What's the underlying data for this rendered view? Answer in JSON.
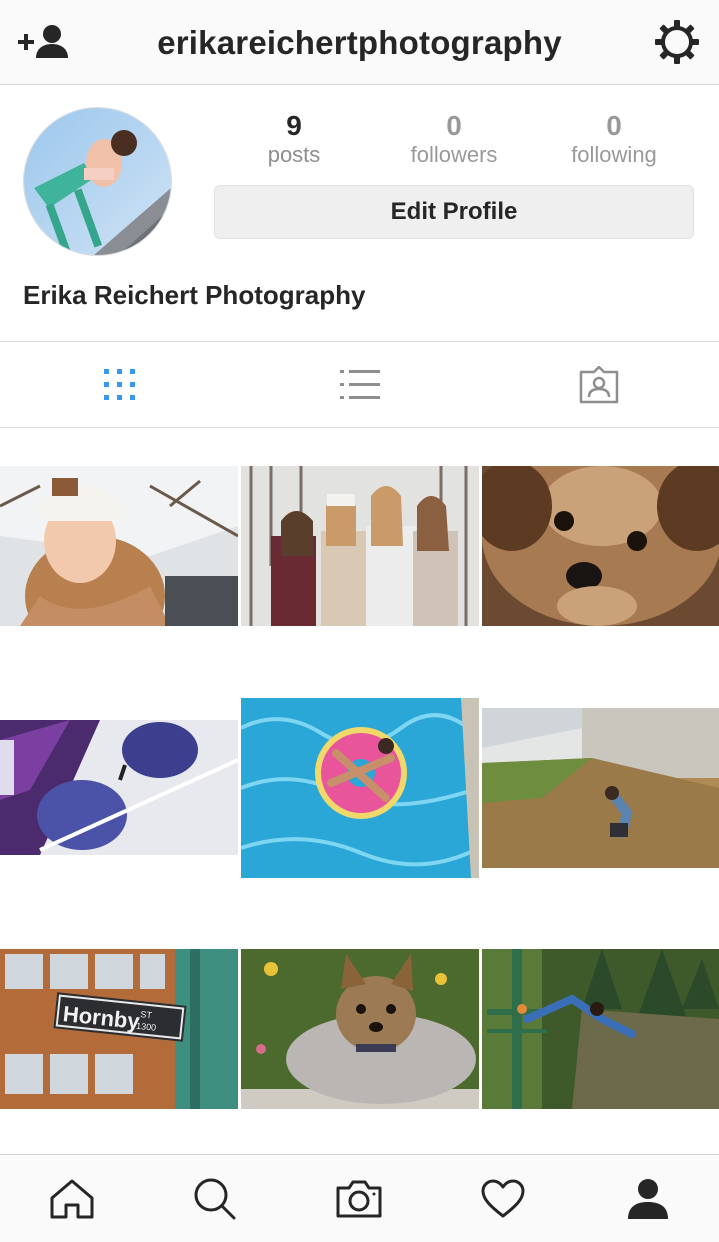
{
  "header": {
    "username": "erikareichertphotography",
    "add_user_icon": "add-person-icon",
    "settings_icon": "gear-icon"
  },
  "profile": {
    "stats": {
      "posts_count": "9",
      "posts_label": "posts",
      "followers_count": "0",
      "followers_label": "followers",
      "following_count": "0",
      "following_label": "following"
    },
    "edit_profile_label": "Edit Profile",
    "display_name": "Erika Reichert Photography"
  },
  "tabs": [
    {
      "icon": "grid-icon",
      "active": true
    },
    {
      "icon": "list-icon",
      "active": false
    },
    {
      "icon": "tagged-icon",
      "active": false
    }
  ],
  "posts": [
    {
      "subject": "girl in white beanie in snow"
    },
    {
      "subject": "four girls laughing in winter woods"
    },
    {
      "subject": "yorkie dog close-up"
    },
    {
      "subject": "reflective aviator sunglasses"
    },
    {
      "subject": "girl on donut float in pool"
    },
    {
      "subject": "person crouching in autumn leaves"
    },
    {
      "subject": "Hornby street sign",
      "sign_text": "Hornby",
      "sign_st": "ST",
      "sign_num": "1300"
    },
    {
      "subject": "yorkie dog in garden"
    },
    {
      "subject": "person on railing in forest"
    }
  ],
  "bottom_nav": [
    {
      "icon": "home-icon"
    },
    {
      "icon": "search-icon"
    },
    {
      "icon": "camera-icon"
    },
    {
      "icon": "heart-icon"
    },
    {
      "icon": "profile-icon",
      "active": true
    }
  ],
  "colors": {
    "accent": "#3897f0",
    "text": "#262626",
    "muted": "#8e8e8e"
  }
}
